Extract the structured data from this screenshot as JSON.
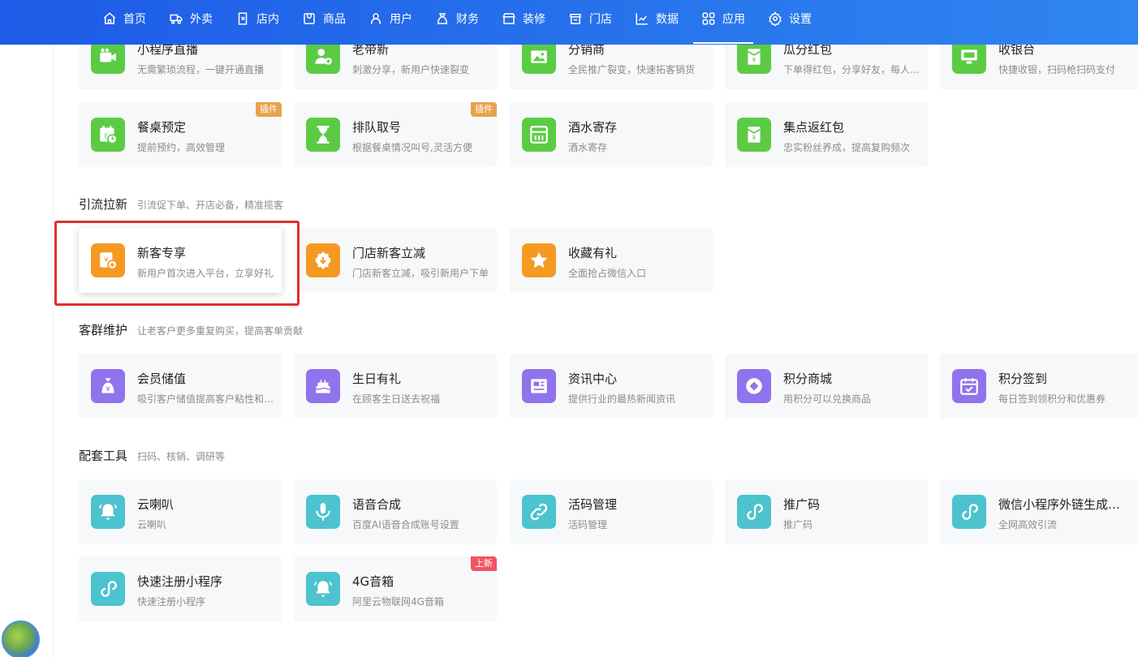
{
  "nav": [
    {
      "label": "首页",
      "icon": "home-icon"
    },
    {
      "label": "外卖",
      "icon": "delivery-icon"
    },
    {
      "label": "店内",
      "icon": "store-inside-icon"
    },
    {
      "label": "商品",
      "icon": "goods-icon"
    },
    {
      "label": "用户",
      "icon": "user-icon"
    },
    {
      "label": "财务",
      "icon": "finance-icon"
    },
    {
      "label": "装修",
      "icon": "decorate-icon"
    },
    {
      "label": "门店",
      "icon": "shop-icon"
    },
    {
      "label": "数据",
      "icon": "chart-icon"
    },
    {
      "label": "应用",
      "icon": "apps-icon"
    },
    {
      "label": "设置",
      "icon": "settings-icon"
    }
  ],
  "cards_top": [
    {
      "title": "小程序直播",
      "desc": "无需繁琐流程，一键开通直播"
    },
    {
      "title": "老带新",
      "desc": "刺激分享，新用户快速裂变"
    },
    {
      "title": "分销商",
      "desc": "全民推广裂变，快速拓客销货"
    },
    {
      "title": "瓜分红包",
      "desc": "下单得红包，分享好友，每人…"
    },
    {
      "title": "收银台",
      "desc": "快捷收银，扫码枪扫码支付"
    },
    {
      "title": "餐桌预定",
      "desc": "提前预约，高效管理",
      "badge": "插件"
    },
    {
      "title": "排队取号",
      "desc": "根据餐桌情况叫号,灵活方便",
      "badge": "插件"
    },
    {
      "title": "酒水寄存",
      "desc": "酒水寄存"
    },
    {
      "title": "集点返红包",
      "desc": "忠实粉丝养成，提高复购频次"
    }
  ],
  "sections": [
    {
      "title": "引流拉新",
      "sub": "引流促下单、开店必备，精准揽客",
      "cards": [
        {
          "title": "新客专享",
          "desc": "新用户首次进入平台，立享好礼"
        },
        {
          "title": "门店新客立减",
          "desc": "门店新客立减，吸引新用户下单"
        },
        {
          "title": "收藏有礼",
          "desc": "全面抢占微信入口"
        }
      ]
    },
    {
      "title": "客群维护",
      "sub": "让老客户更多重复购买，提高客单贡献",
      "cards": [
        {
          "title": "会员储值",
          "desc": "吸引客户储值提高客户粘性和…"
        },
        {
          "title": "生日有礼",
          "desc": "在顾客生日送去祝福"
        },
        {
          "title": "资讯中心",
          "desc": "提供行业的最热新闻资讯"
        },
        {
          "title": "积分商城",
          "desc": "用积分可以兑换商品"
        },
        {
          "title": "积分签到",
          "desc": "每日签到领积分和优惠券"
        }
      ]
    },
    {
      "title": "配套工具",
      "sub": "扫码、核销、调研等",
      "cards": [
        {
          "title": "云喇叭",
          "desc": "云喇叭"
        },
        {
          "title": "语音合成",
          "desc": "百度AI语音合成账号设置"
        },
        {
          "title": "活码管理",
          "desc": "活码管理"
        },
        {
          "title": "推广码",
          "desc": "推广码"
        },
        {
          "title": "微信小程序外链生成…",
          "desc": "全网高效引流"
        },
        {
          "title": "快速注册小程序",
          "desc": "快速注册小程序"
        },
        {
          "title": "4G音箱",
          "desc": "阿里云物联网4G音箱",
          "badge": "上新"
        }
      ]
    }
  ],
  "colors": {
    "nav_start": "#1e5be8",
    "nav_end": "#2f86f0",
    "green": "#5ccb44",
    "orange": "#f59a21",
    "purple": "#9173ed",
    "teal": "#4cc3cf",
    "highlight": "#e02d2d"
  }
}
